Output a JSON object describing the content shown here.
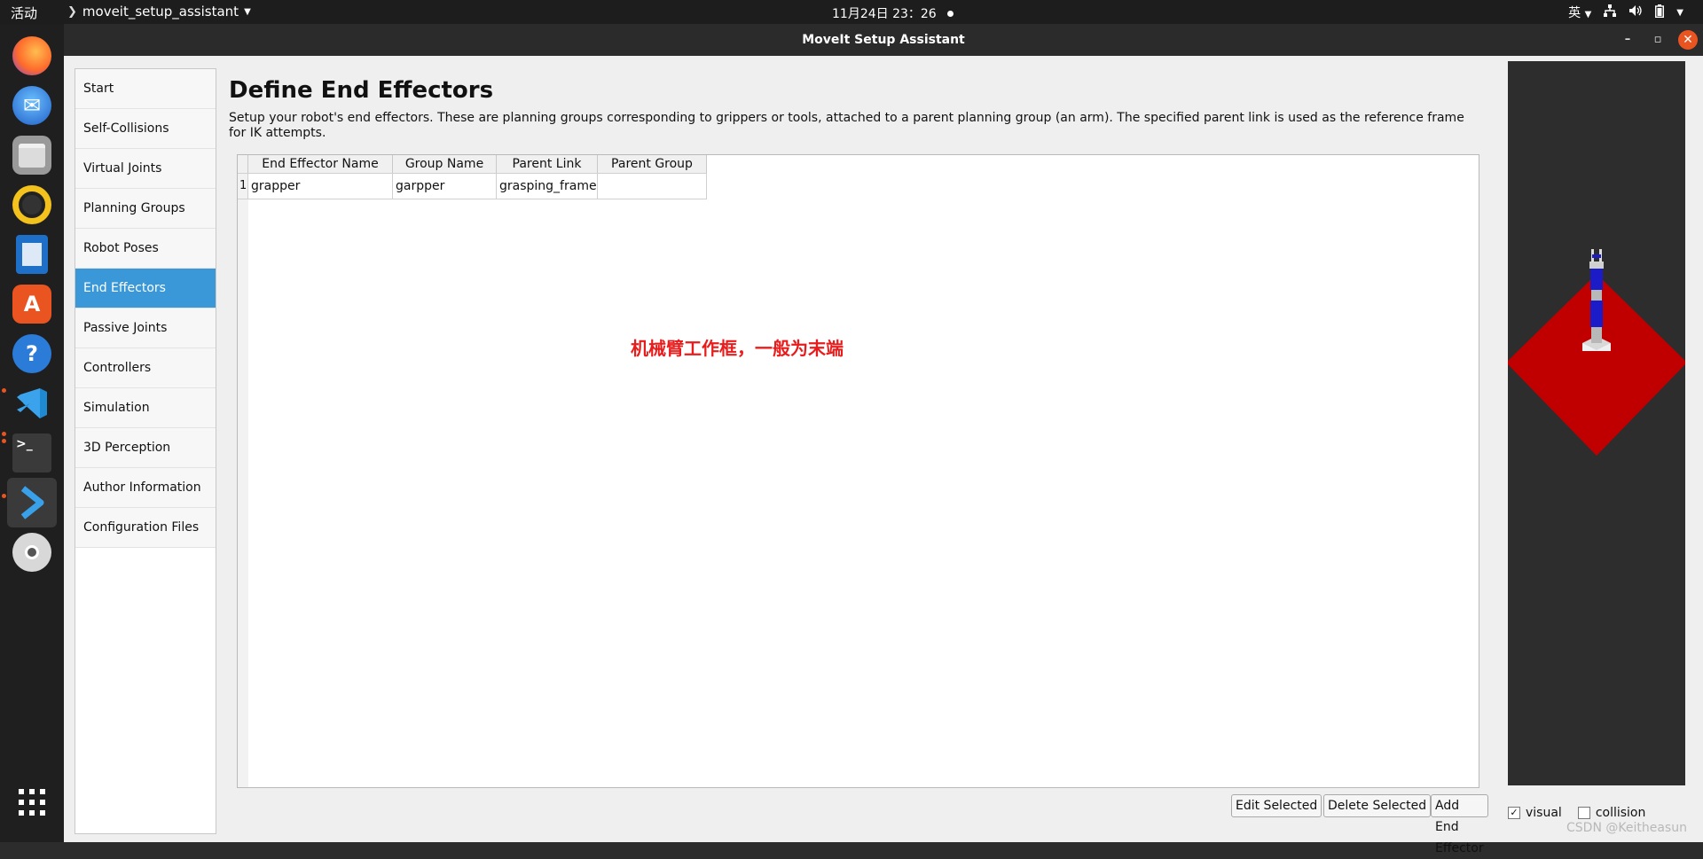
{
  "topbar": {
    "activities": "活动",
    "app_name": "moveit_setup_assistant",
    "clock": "11月24日  23：26",
    "input_method": "英"
  },
  "dock": {
    "items": [
      "firefox-icon",
      "thunderbird-icon",
      "files-icon",
      "rhythmbox-icon",
      "libreoffice-writer-icon",
      "app-center-icon",
      "help-icon",
      "vscode-icon",
      "terminal-icon",
      "moveit-icon",
      "disc-icon",
      "show-apps-icon"
    ],
    "accent": "#e95420"
  },
  "window": {
    "title": "MoveIt Setup Assistant"
  },
  "nav": {
    "items": [
      {
        "label": "Start"
      },
      {
        "label": "Self-Collisions"
      },
      {
        "label": "Virtual Joints"
      },
      {
        "label": "Planning Groups"
      },
      {
        "label": "Robot Poses"
      },
      {
        "label": "End Effectors",
        "selected": true
      },
      {
        "label": "Passive Joints"
      },
      {
        "label": "Controllers"
      },
      {
        "label": "Simulation"
      },
      {
        "label": "3D Perception"
      },
      {
        "label": "Author Information"
      },
      {
        "label": "Configuration Files"
      }
    ],
    "selected_color": "#3a98d8"
  },
  "main": {
    "title": "Define End Effectors",
    "description": "Setup your robot's end effectors. These are planning groups corresponding to grippers or tools, attached to a parent planning group (an arm). The specified parent link is used as the reference frame for IK attempts.",
    "table": {
      "columns": [
        "End Effector Name",
        "Group Name",
        "Parent Link",
        "Parent Group"
      ],
      "rows": [
        {
          "num": "1",
          "cells": [
            "grapper",
            "garpper",
            "grasping_frame",
            ""
          ]
        }
      ]
    },
    "annotation": "机械臂工作框，一般为末端",
    "annotation_color": "#e81c1c",
    "buttons": {
      "edit": "Edit Selected",
      "delete": "Delete Selected",
      "add": "Add End Effector"
    }
  },
  "viewport": {
    "visual_label": "visual",
    "visual_checked": true,
    "collision_label": "collision",
    "collision_checked": false,
    "plane_color": "#c00000"
  },
  "watermark": "CSDN @Keitheasun"
}
